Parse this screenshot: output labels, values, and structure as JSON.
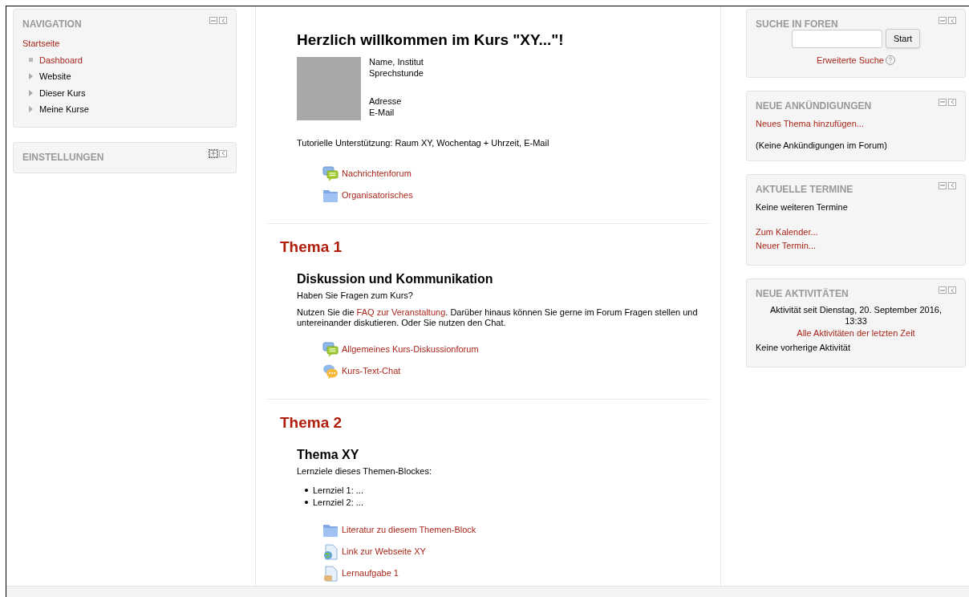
{
  "navigation": {
    "title": "NAVIGATION",
    "collapsed": false,
    "home": "Startseite",
    "items": [
      {
        "label": "Dashboard",
        "kind": "leaf",
        "link": true
      },
      {
        "label": "Website",
        "kind": "branch",
        "link": false
      },
      {
        "label": "Dieser Kurs",
        "kind": "branch",
        "link": false
      },
      {
        "label": "Meine Kurse",
        "kind": "branch",
        "link": false
      }
    ]
  },
  "settings": {
    "title": "EINSTELLUNGEN",
    "collapsed": true
  },
  "intro": {
    "title": "Herzlich willkommen im Kurs \"XY...\"!",
    "contact_groups": [
      [
        "Name, Institut",
        "Sprechstunde"
      ],
      [
        "Adresse",
        "E-Mail"
      ]
    ],
    "support": "Tutorielle Unterstützung: Raum XY, Wochentag + Uhrzeit, E-Mail",
    "activities": [
      {
        "kind": "forum",
        "label": "Nachrichtenforum"
      },
      {
        "kind": "folder",
        "label": "Organisatorisches"
      }
    ]
  },
  "sections": [
    {
      "title": "Thema 1",
      "subtitle": "Diskussion und Kommunikation",
      "paragraphs": [
        [
          {
            "kind": "text",
            "text": "Haben Sie Fragen zum Kurs?"
          }
        ],
        [
          {
            "kind": "text",
            "text": "Nutzen Sie die "
          },
          {
            "kind": "link",
            "text": "FAQ zur Veranstaltung"
          },
          {
            "kind": "text",
            "text": ". Darüber hinaus können Sie gerne im Forum Fragen stellen und untereinander diskutieren. Oder Sie nutzen den Chat."
          }
        ]
      ],
      "activities": [
        {
          "kind": "forum",
          "label": "Allgemeines Kurs-Diskussionforum"
        },
        {
          "kind": "chat",
          "label": "Kurs-Text-Chat"
        }
      ]
    },
    {
      "title": "Thema 2",
      "subtitle": "Thema XY",
      "paragraphs": [
        [
          {
            "kind": "text",
            "text": "Lernziele dieses Themen-Blockes:"
          }
        ]
      ],
      "bullets": [
        "Lernziel 1: ...",
        "Lernziel 2: ..."
      ],
      "activities": [
        {
          "kind": "folder",
          "label": "Literatur zu diesem Themen-Block"
        },
        {
          "kind": "url",
          "label": "Link zur Webseite XY"
        },
        {
          "kind": "file",
          "label": "Lernaufgabe 1"
        }
      ]
    }
  ],
  "right_blocks": [
    {
      "kind": "search",
      "title": "SUCHE IN FOREN",
      "button": "Start",
      "link": "Erweiterte Suche"
    },
    {
      "kind": "news",
      "title": "NEUE ANKÜNDIGUNGEN",
      "link": "Neues Thema hinzufügen...",
      "text": "(Keine Ankündigungen im Forum)"
    },
    {
      "kind": "events",
      "title": "AKTUELLE TERMINE",
      "text": "Keine weiteren Termine",
      "links": [
        "Zum Kalender...",
        "Neuer Termin..."
      ]
    },
    {
      "kind": "activity",
      "title": "NEUE AKTIVITÄTEN",
      "since": "Aktivität seit Dienstag, 20. September 2016, 13:33",
      "link": "Alle Aktivitäten der letzten Zeit",
      "text": "Keine vorherige Aktivität"
    }
  ]
}
